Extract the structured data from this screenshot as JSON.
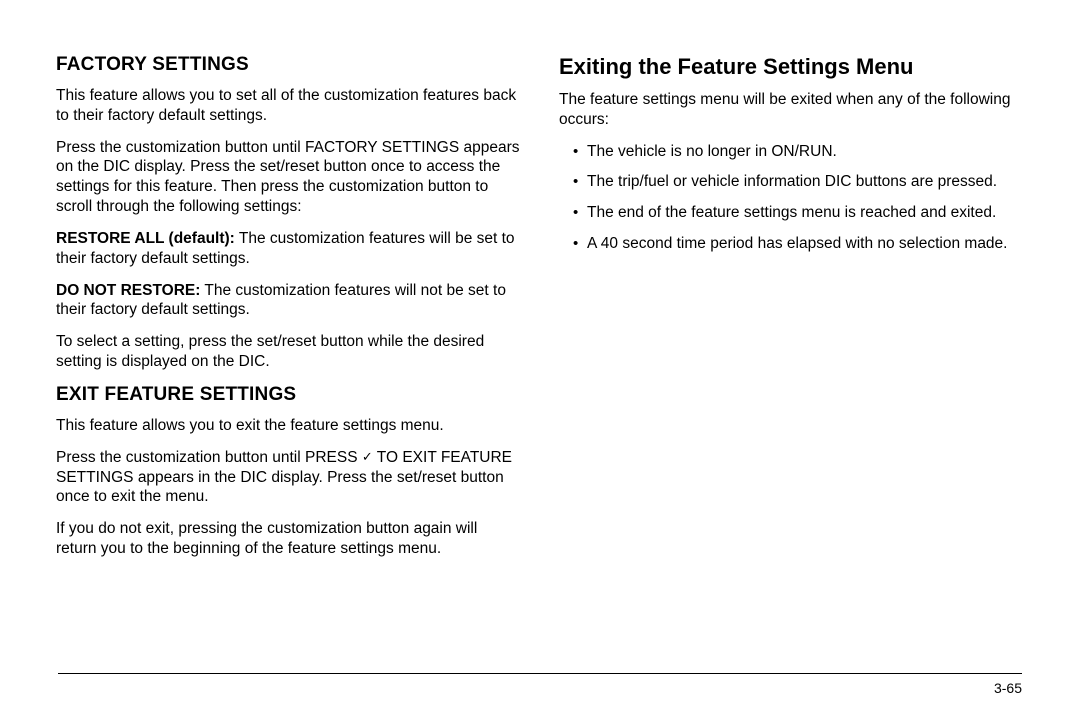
{
  "left": {
    "heading1": "FACTORY SETTINGS",
    "p1": "This feature allows you to set all of the customization features back to their factory default settings.",
    "p2": "Press the customization button until FACTORY SETTINGS appears on the DIC display. Press the set/reset button once to access the settings for this feature. Then press the customization button to scroll through the following settings:",
    "restore_lead": "RESTORE ALL (default):",
    "restore_rest": "  The customization features will be set to their factory default settings.",
    "donot_lead": "DO NOT RESTORE:",
    "donot_rest": "  The customization features will not be set to their factory default settings.",
    "p5": "To select a setting, press the set/reset button while the desired setting is displayed on the DIC.",
    "heading2": "EXIT FEATURE SETTINGS",
    "p6": "This feature allows you to exit the feature settings menu.",
    "p7a": "Press the customization button until PRESS ",
    "p7b": " TO EXIT FEATURE SETTINGS appears in the DIC display. Press the set/reset button once to exit the menu.",
    "p8": "If you do not exit, pressing the customization button again will return you to the beginning of the feature settings menu."
  },
  "right": {
    "heading": "Exiting the Feature Settings Menu",
    "intro": "The feature settings menu will be exited when any of the following occurs:",
    "items": [
      "The vehicle is no longer in ON/RUN.",
      "The trip/fuel or vehicle information DIC buttons are pressed.",
      "The end of the feature settings menu is reached and exited.",
      "A 40 second time period has elapsed with no selection made."
    ]
  },
  "page_number": "3-65",
  "checkmark_glyph": "✓"
}
